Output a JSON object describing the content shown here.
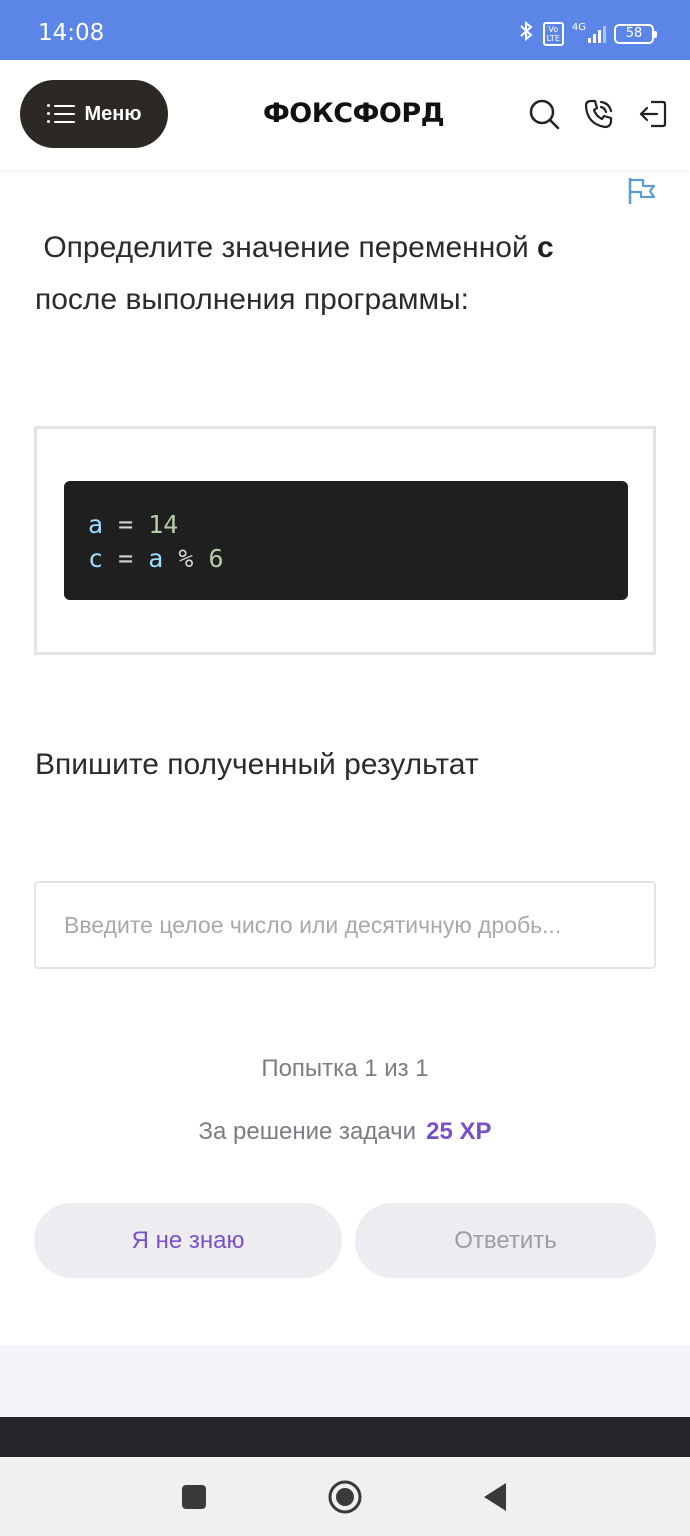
{
  "status_bar": {
    "time": "14:08",
    "volte_label": "Vo\nLTE",
    "network_label": "4G",
    "battery": "58",
    "icons": [
      "bluetooth-icon",
      "volte-icon",
      "signal-icon",
      "battery-icon"
    ]
  },
  "header": {
    "menu_label": "Меню",
    "logo": "ФОКСФОРД",
    "icons": [
      "search-icon",
      "phone-icon",
      "logout-icon"
    ]
  },
  "task": {
    "question_prefix": " Определите значение переменной ",
    "question_var": "c",
    "question_suffix": " после выполнения программы:",
    "code": {
      "line1": {
        "var": "a",
        "op": " = ",
        "num": "14"
      },
      "line2": {
        "var": "c",
        "op": " = ",
        "var2": "a",
        "op2": " % ",
        "num": "6"
      }
    },
    "prompt": "Впишите полученный результат",
    "input_placeholder": "Введите целое число или десятичную дробь...",
    "input_value": "",
    "attempt_text": "Попытка 1 из 1",
    "reward_text": "За решение задачи",
    "reward_xp": "25 XP",
    "dont_know_label": "Я не знаю",
    "answer_label": "Ответить"
  },
  "colors": {
    "status_bar": "#5b86e8",
    "menu_button": "#2c2824",
    "accent": "#7b4fc7",
    "flag": "#5b9bd5",
    "code_bg": "#1f1f1f"
  },
  "navigation": {
    "icons": [
      "recent-apps-icon",
      "home-icon",
      "back-icon"
    ]
  }
}
